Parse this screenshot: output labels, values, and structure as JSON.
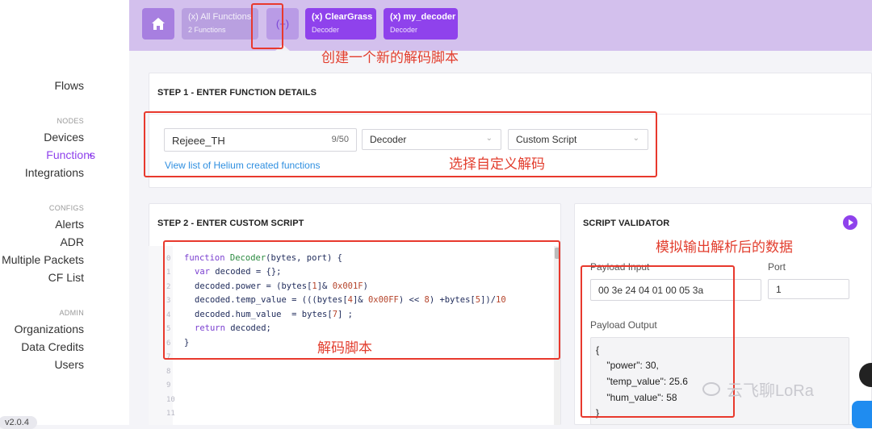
{
  "sidebar": {
    "flows": "Flows",
    "nodes_section": "NODES",
    "devices": "Devices",
    "functions": "Functions",
    "active_marker": "‹",
    "integrations": "Integrations",
    "configs_section": "CONFIGS",
    "alerts": "Alerts",
    "adr": "ADR",
    "multiple_packets": "Multiple Packets",
    "cf_list": "CF List",
    "admin_section": "ADMIN",
    "organizations": "Organizations",
    "data_credits": "Data Credits",
    "users": "Users",
    "version": "v2.0.4"
  },
  "topbar": {
    "home_icon": "home-icon",
    "all_functions": {
      "title": "(x) All Functions",
      "subtitle": "2 Functions"
    },
    "add_label": "(+)",
    "chips": [
      {
        "title": "(x) ClearGrass",
        "subtitle": "Decoder"
      },
      {
        "title": "(x) my_decoder",
        "subtitle": "Decoder"
      }
    ]
  },
  "step1": {
    "title": "STEP 1 - ENTER FUNCTION DETAILS",
    "name_value": "Rejeee_TH",
    "name_count": "9/50",
    "type_value": "Decoder",
    "format_value": "Custom Script",
    "link": "View list of Helium created functions"
  },
  "step2": {
    "title": "STEP 2 - ENTER CUSTOM SCRIPT",
    "line_numbers": [
      "0",
      "1",
      "2",
      "3",
      "4",
      "5",
      "6",
      "7",
      "8",
      "9",
      "10",
      "11"
    ],
    "code": {
      "l0_kw": "function",
      "l0_fn": "Decoder",
      "l0_rest": "(bytes, port) {",
      "l1_kw": "var",
      "l1_rest": " decoded = {};",
      "l2_a": "decoded.power = (bytes[",
      "l2_n1": "1",
      "l2_b": "]& ",
      "l2_n2": "0x001F",
      "l2_c": ")",
      "l3_a": "decoded.temp_value = (((bytes[",
      "l3_n1": "4",
      "l3_b": "]& ",
      "l3_n2": "0x00FF",
      "l3_c": ") << ",
      "l3_n3": "8",
      "l3_d": ") +bytes[",
      "l3_n4": "5",
      "l3_e": "])/",
      "l3_n5": "10",
      "l4_a": "decoded.hum_value  = bytes[",
      "l4_n1": "7",
      "l4_b": "] ;",
      "l5_kw": "return",
      "l5_rest": " decoded;",
      "l6": "}"
    }
  },
  "validator": {
    "title": "SCRIPT VALIDATOR",
    "payload_label": "Payload Input",
    "payload_value": "00 3e 24 04 01 00 05 3a",
    "port_label": "Port",
    "port_value": "1",
    "output_label": "Payload Output",
    "output_lines": [
      "{",
      "    \"power\": 30,",
      "    \"temp_value\": 25.6",
      "    \"hum_value\": 58",
      "}"
    ]
  },
  "annotations": {
    "new_decoder": "创建一个新的解码脚本",
    "custom_decode": "选择自定义解码",
    "decode_script": "解码脚本",
    "simulate_output": "模拟输出解析后的数据"
  },
  "watermark": "云飞聊LoRa",
  "colors": {
    "accent": "#8f42ec",
    "topbar": "#d3c0ed",
    "annotation": "#e8392d"
  }
}
